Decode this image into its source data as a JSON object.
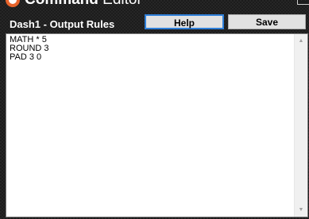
{
  "window": {
    "title_bold": "Command",
    "title_rest": " Editor",
    "close_glyph": "✕"
  },
  "header": {
    "title": "Dash1 - Output Rules"
  },
  "toolbar": {
    "help_label": "Help",
    "save_label": "Save"
  },
  "editor": {
    "content": "MATH * 5\nROUND 3\nPAD 3 0"
  },
  "scrollbar": {
    "up_glyph": "▲",
    "down_glyph": "▼"
  },
  "colors": {
    "background": "#1c1c1c",
    "help_border": "#2f7fd8",
    "app_icon": "#e8642c"
  }
}
